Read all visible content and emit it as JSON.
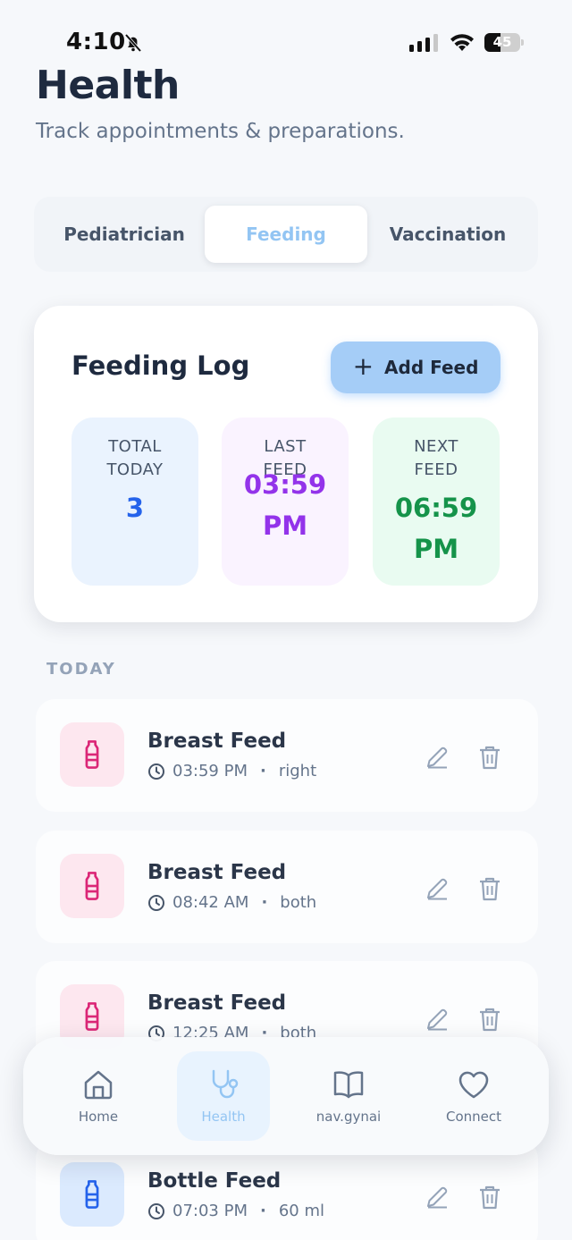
{
  "status_bar": {
    "time": "4:10",
    "battery": "45",
    "battery_level": 0.45
  },
  "header": {
    "title": "Health",
    "subtitle": "Track appointments & preparations."
  },
  "tabs": [
    {
      "label": "Pediatrician",
      "active": false
    },
    {
      "label": "Feeding",
      "active": true
    },
    {
      "label": "Vaccination",
      "active": false
    }
  ],
  "feeding_log": {
    "title": "Feeding Log",
    "add_button": "Add Feed",
    "stats": {
      "total": {
        "label": "TOTAL TODAY",
        "value": "3"
      },
      "last": {
        "label": "LAST FEED",
        "value": "03:59 PM"
      },
      "next": {
        "label": "NEXT FEED",
        "value": "06:59 PM"
      }
    }
  },
  "section_label": "TODAY",
  "entries": [
    {
      "title": "Breast Feed",
      "time": "03:59 PM",
      "detail": "right",
      "icon": "bottle-icon",
      "color": "#db2777"
    },
    {
      "title": "Breast Feed",
      "time": "08:42 AM",
      "detail": "both",
      "icon": "bottle-icon",
      "color": "#db2777"
    },
    {
      "title": "Breast Feed",
      "time": "12:25 AM",
      "detail": "both",
      "icon": "bottle-icon",
      "color": "#db2777"
    },
    {
      "title": "Bottle Feed",
      "time": "07:03 PM",
      "detail": "60 ml",
      "icon": "bottle-icon",
      "color": "#2563eb"
    }
  ],
  "bottom_nav": [
    {
      "label": "Home",
      "icon": "home-icon",
      "active": false
    },
    {
      "label": "Health",
      "icon": "stethoscope-icon",
      "active": true
    },
    {
      "label": "nav.gynai",
      "icon": "book-icon",
      "active": false
    },
    {
      "label": "Connect",
      "icon": "heart-icon",
      "active": false
    }
  ],
  "colors": {
    "accent": "#93c5f3",
    "total_value": "#2563eb",
    "last_value": "#9333ea",
    "next_value": "#15934a"
  }
}
